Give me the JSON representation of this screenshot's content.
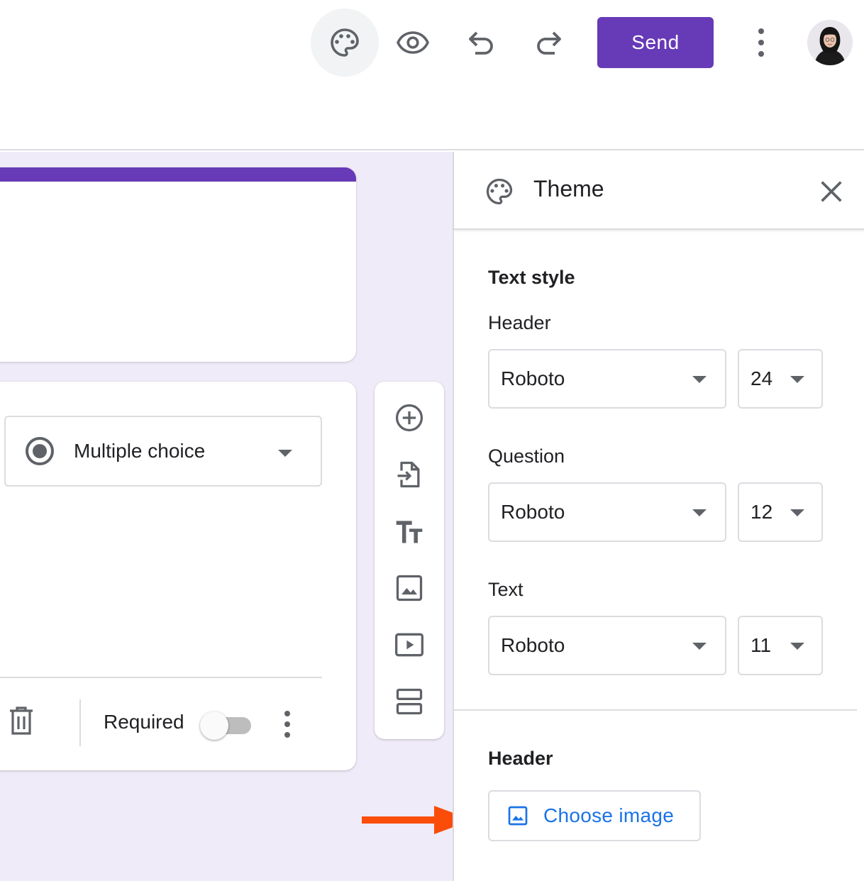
{
  "toolbar": {
    "icons": {
      "palette": "palette-icon",
      "preview": "eye-icon",
      "undo": "undo-icon",
      "redo": "redo-icon",
      "more": "more-vert-icon"
    },
    "send_label": "Send",
    "accent_color": "#673ab7"
  },
  "question": {
    "type_label": "Multiple choice",
    "required_label": "Required",
    "required_on": false
  },
  "side_tools": [
    "add-question-icon",
    "import-questions-icon",
    "add-title-icon",
    "add-image-icon",
    "add-video-icon",
    "add-section-icon"
  ],
  "theme_panel": {
    "title": "Theme",
    "text_style_title": "Text style",
    "header": {
      "label": "Header",
      "font": "Roboto",
      "size": "24"
    },
    "question": {
      "label": "Question",
      "font": "Roboto",
      "size": "12"
    },
    "text": {
      "label": "Text",
      "font": "Roboto",
      "size": "11"
    },
    "header_section_title": "Header",
    "choose_image_label": "Choose image",
    "link_color": "#1a73e8"
  },
  "annotation": {
    "arrow_color": "#fa4d0a"
  }
}
